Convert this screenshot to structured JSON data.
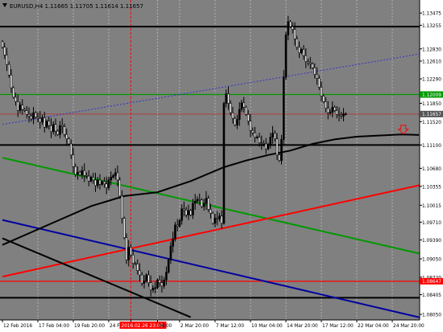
{
  "symbol_info": "EURUSD,H4  1.11665 1.11705 1.11614 1.11657",
  "chart_data": {
    "type": "candlestick",
    "symbol": "EURUSD",
    "timeframe": "H4",
    "ohlc_header": {
      "open": 1.11665,
      "high": 1.11705,
      "low": 1.11614,
      "close": 1.11657
    },
    "colors": {
      "background": "#808080",
      "candle": "#000000",
      "moving_average": "#000000",
      "trend_green": "#009900",
      "trend_red": "#ff0000",
      "trend_blue": "#0000a0",
      "channel_dotted": "#3333cc",
      "axis_text": "#000000",
      "vertical_lines": "#b0b0b0",
      "marker_vertical": "#ff0000"
    },
    "price_axis": {
      "range": [
        1.0795,
        1.1371
      ],
      "ticks": [
        "1.13475",
        "1.13255",
        "1.12830",
        "1.12610",
        "1.12290",
        "1.11850",
        "1.11520",
        "1.11100",
        "1.10680",
        "1.10355",
        "1.10015",
        "1.09710",
        "1.09390",
        "1.09050",
        "1.08720",
        "1.08405",
        "1.08050"
      ],
      "tick_values": [
        1.13475,
        1.13255,
        1.1283,
        1.1261,
        1.1229,
        1.1185,
        1.1152,
        1.111,
        1.1068,
        1.10355,
        1.10015,
        1.0971,
        1.0939,
        1.0905,
        1.0872,
        1.08405,
        1.0805
      ],
      "price_tags": [
        {
          "text": "1.12009",
          "value": 1.12009,
          "color": "#009900"
        },
        {
          "text": "1.11657",
          "value": 1.11657,
          "color": "#555555"
        },
        {
          "text": "1.08647",
          "value": 1.08647,
          "color": "#ff0000"
        }
      ]
    },
    "time_axis": {
      "labels": [
        "12 Feb 2016",
        "17 Feb 04:00",
        "19 Feb 20:00",
        "24 Feb 12:00",
        "2016.02.26 23:00",
        "04:00",
        "2 Mar 20:00",
        "7 Mar 12:00",
        "10 Mar 04:00",
        "14 Mar 20:00",
        "17 Mar 12:00",
        "22 Mar 04:00",
        "24 Mar 20:00"
      ],
      "label_indices": [
        0,
        16,
        32,
        48,
        58,
        70,
        80,
        96,
        112,
        128,
        144,
        160,
        176
      ],
      "cursor_label": "2016.02.26 23:00",
      "cursor_index": 58
    },
    "closes": [
      1.1286,
      1.1272,
      1.1255,
      1.1236,
      1.1213,
      1.1196,
      1.1188,
      1.1172,
      1.1182,
      1.1174,
      1.1172,
      1.1165,
      1.1162,
      1.1157,
      1.1168,
      1.116,
      1.1158,
      1.1151,
      1.1159,
      1.1142,
      1.1153,
      1.1145,
      1.1134,
      1.1147,
      1.1135,
      1.1129,
      1.1145,
      1.1143,
      1.1129,
      1.1121,
      1.1112,
      1.1092,
      1.1071,
      1.1057,
      1.1061,
      1.1056,
      1.1064,
      1.1055,
      1.1054,
      1.1045,
      1.1052,
      1.1047,
      1.1037,
      1.1047,
      1.1039,
      1.1044,
      1.104,
      1.1033,
      1.1047,
      1.1052,
      1.1055,
      1.106,
      1.1047,
      1.1018,
      1.0978,
      1.0943,
      1.0903,
      1.0926,
      1.0912,
      1.0897,
      1.0896,
      1.0884,
      1.0876,
      1.0861,
      1.0865,
      1.0876,
      1.0862,
      1.0849,
      1.0852,
      1.0853,
      1.0867,
      1.0862,
      1.0856,
      1.0867,
      1.0881,
      1.0903,
      1.0928,
      1.0941,
      1.0966,
      1.0964,
      1.0974,
      1.0995,
      1.0993,
      1.0984,
      1.0992,
      1.0984,
      1.1005,
      1.1009,
      1.1012,
      1.1011,
      1.0999,
      1.1005,
      1.1014,
      1.0994,
      1.0987,
      1.0969,
      1.0978,
      1.0977,
      1.0982,
      1.0969,
      1.1185,
      1.1202,
      1.1185,
      1.1168,
      1.1158,
      1.1146,
      1.1156,
      1.1174,
      1.1186,
      1.1178,
      1.1165,
      1.1153,
      1.1136,
      1.1132,
      1.1124,
      1.1124,
      1.1114,
      1.1113,
      1.1112,
      1.1103,
      1.1111,
      1.1124,
      1.1131,
      1.1121,
      1.1092,
      1.1082,
      1.112,
      1.1232,
      1.1308,
      1.1332,
      1.1323,
      1.1318,
      1.1301,
      1.1286,
      1.1276,
      1.1282,
      1.1271,
      1.126,
      1.1258,
      1.1256,
      1.1249,
      1.1237,
      1.123,
      1.1214,
      1.1198,
      1.1188,
      1.1176,
      1.1168,
      1.1169,
      1.1178,
      1.1172,
      1.1165,
      1.1164,
      1.1162,
      1.1166,
      1.1166
    ],
    "moving_average": {
      "points": [
        [
          0,
          1.093
        ],
        [
          20,
          1.0965
        ],
        [
          40,
          1.1
        ],
        [
          55,
          1.1018
        ],
        [
          70,
          1.1025
        ],
        [
          85,
          1.1045
        ],
        [
          100,
          1.107
        ],
        [
          110,
          1.1082
        ],
        [
          120,
          1.1092
        ],
        [
          130,
          1.11
        ],
        [
          140,
          1.1112
        ],
        [
          150,
          1.112
        ],
        [
          160,
          1.1125
        ],
        [
          170,
          1.1127
        ],
        [
          180,
          1.1129
        ],
        [
          188,
          1.1128
        ]
      ]
    },
    "horizontal_lines": [
      {
        "value": 1.1323,
        "color": "#000000"
      },
      {
        "value": 1.12009,
        "color": "#009900"
      },
      {
        "value": 1.11657,
        "color": "#b04040",
        "thin": true
      },
      {
        "value": 1.111,
        "color": "#000000"
      },
      {
        "value": 1.08647,
        "color": "#ff0000"
      },
      {
        "value": 1.0835,
        "color": "#000000"
      }
    ],
    "trendlines": [
      {
        "color": "#009900",
        "from": [
          0,
          1.1087
        ],
        "to": [
          190,
          1.0913
        ]
      },
      {
        "color": "#ff0000",
        "from": [
          0,
          1.0873
        ],
        "to": [
          190,
          1.1039
        ]
      },
      {
        "color": "#0000a0",
        "from": [
          0,
          1.0975
        ],
        "to": [
          190,
          1.0798
        ]
      },
      {
        "color": "#000000",
        "from": [
          0,
          1.0942
        ],
        "to": [
          85,
          1.08
        ]
      },
      {
        "color": "#3333cc",
        "from": [
          0,
          1.1147
        ],
        "to": [
          190,
          1.1275
        ],
        "dashed": true
      }
    ],
    "vertical_gridlines": [
      16,
      32,
      48,
      70,
      80,
      96,
      112,
      128,
      144,
      160,
      176
    ],
    "marker": {
      "type": "down-arrow",
      "index": 181,
      "value": 1.1137,
      "color": "#ff0000"
    }
  }
}
